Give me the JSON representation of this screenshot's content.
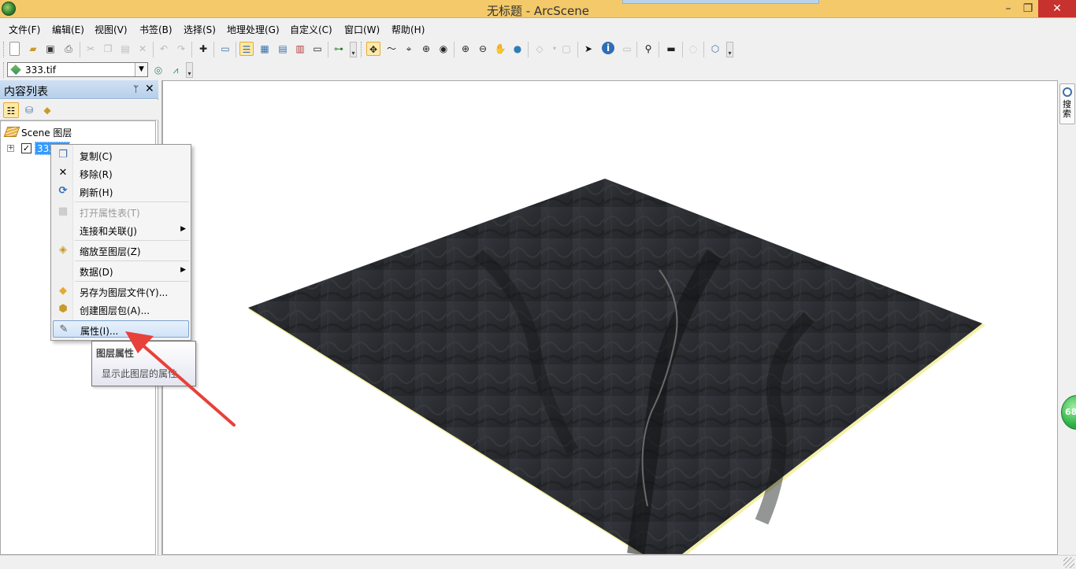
{
  "window": {
    "title": "无标题 - ArcScene",
    "minimize": "–",
    "maximize": "❐",
    "close": "✕"
  },
  "menu": [
    "文件(F)",
    "编辑(E)",
    "视图(V)",
    "书签(B)",
    "选择(S)",
    "地理处理(G)",
    "自定义(C)",
    "窗口(W)",
    "帮助(H)"
  ],
  "layer_combo": {
    "value": "333.tif"
  },
  "toc": {
    "title": "内容列表",
    "pin": "ᛘ",
    "close": "✕",
    "scene_label": "Scene 图层",
    "layer_name": "333.tif",
    "checked": "✓"
  },
  "context_menu": {
    "items": [
      {
        "label": "复制(C)",
        "icon": "copy-icon",
        "glyph": "📄",
        "disabled": false,
        "submenu": false
      },
      {
        "label": "移除(R)",
        "icon": "remove-icon",
        "glyph": "✕",
        "disabled": false,
        "submenu": false
      },
      {
        "label": "刷新(H)",
        "icon": "refresh-icon",
        "glyph": "⟳",
        "disabled": false,
        "submenu": false
      },
      {
        "label": "打开属性表(T)",
        "icon": "table-icon",
        "glyph": "▦",
        "disabled": true,
        "submenu": false
      },
      {
        "label": "连接和关联(J)",
        "icon": "",
        "glyph": "",
        "disabled": false,
        "submenu": true
      },
      {
        "label": "缩放至图层(Z)",
        "icon": "zoom-layer-icon",
        "glyph": "◈",
        "disabled": false,
        "submenu": false
      },
      {
        "label": "数据(D)",
        "icon": "",
        "glyph": "",
        "disabled": false,
        "submenu": true
      },
      {
        "label": "另存为图层文件(Y)...",
        "icon": "save-layer-icon",
        "glyph": "◆",
        "disabled": false,
        "submenu": false
      },
      {
        "label": "创建图层包(A)...",
        "icon": "package-icon",
        "glyph": "⬢",
        "disabled": false,
        "submenu": false
      },
      {
        "label": "属性(I)...",
        "icon": "properties-icon",
        "glyph": "✎",
        "disabled": false,
        "submenu": false,
        "highlighted": true
      }
    ],
    "submenu_arrow": "▶"
  },
  "tooltip": {
    "title": "图层属性",
    "description": "显示此图层的属性"
  },
  "search_tab": {
    "label": "搜索"
  },
  "badge": {
    "value": "68"
  },
  "colors": {
    "accent": "#3399ff",
    "title_bar": "#f3c96a",
    "close": "#c7312e",
    "arrow": "#e8403a"
  }
}
